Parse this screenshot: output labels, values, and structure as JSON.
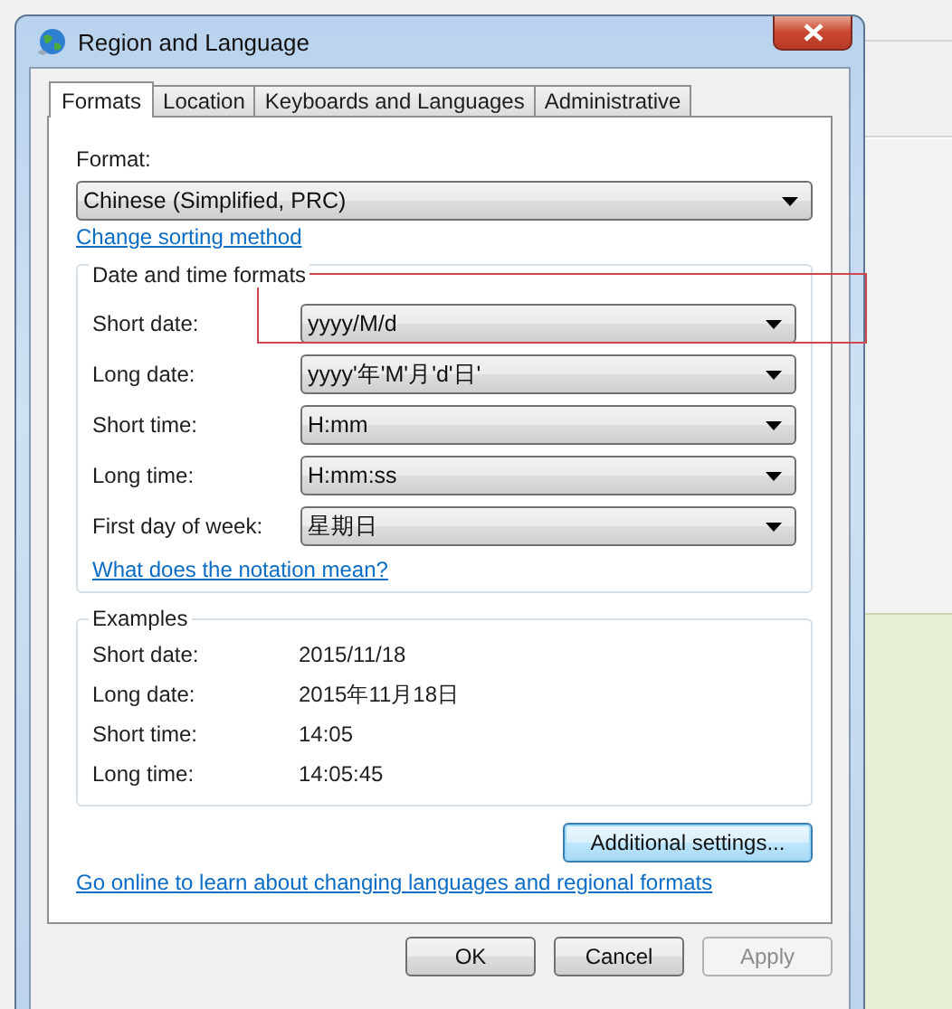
{
  "window": {
    "title": "Region and Language"
  },
  "tabs": [
    {
      "label": "Formats",
      "selected": true
    },
    {
      "label": "Location",
      "selected": false
    },
    {
      "label": "Keyboards and Languages",
      "selected": false
    },
    {
      "label": "Administrative",
      "selected": false
    }
  ],
  "format": {
    "label": "Format:",
    "value": "Chinese (Simplified, PRC)"
  },
  "sorting_link": "Change sorting method",
  "date_time_formats": {
    "title": "Date and time formats",
    "rows": [
      {
        "label": "Short date:",
        "value": "yyyy/M/d",
        "highlighted": true
      },
      {
        "label": "Long date:",
        "value": "yyyy'年'M'月'd'日'",
        "highlighted": false
      },
      {
        "label": "Short time:",
        "value": "H:mm",
        "highlighted": false
      },
      {
        "label": "Long time:",
        "value": "H:mm:ss",
        "highlighted": false
      },
      {
        "label": "First day of week:",
        "value": "星期日",
        "highlighted": false
      }
    ],
    "notation_link": "What does the notation mean?"
  },
  "examples": {
    "title": "Examples",
    "rows": [
      {
        "label": "Short date:",
        "value": "2015/11/18"
      },
      {
        "label": "Long date:",
        "value": "2015年11月18日"
      },
      {
        "label": "Short time:",
        "value": "14:05"
      },
      {
        "label": "Long time:",
        "value": "14:05:45"
      }
    ]
  },
  "additional_settings_button": {
    "label": "Additional settings...",
    "focused": true
  },
  "online_link": "Go online to learn about changing languages and regional formats",
  "buttons": [
    {
      "label": "OK",
      "disabled": false
    },
    {
      "label": "Cancel",
      "disabled": false
    },
    {
      "label": "Apply",
      "disabled": true
    }
  ]
}
